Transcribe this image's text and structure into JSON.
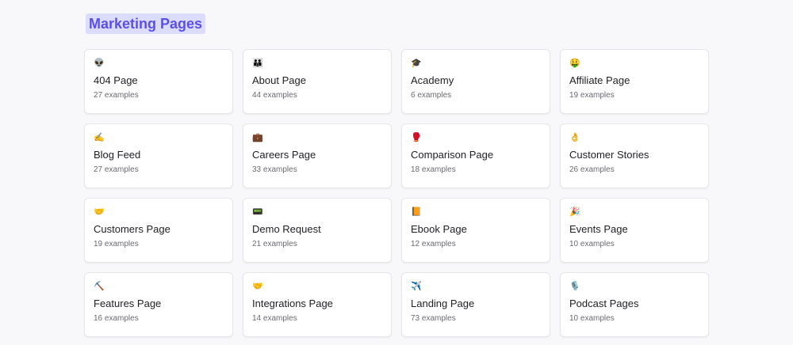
{
  "section": {
    "title": "Marketing Pages"
  },
  "cards": [
    {
      "emoji": "👽",
      "icon": "alien-icon",
      "name": "404 Page",
      "count": "27 examples"
    },
    {
      "emoji": "👪",
      "icon": "family-icon",
      "name": "About Page",
      "count": "44 examples"
    },
    {
      "emoji": "🎓",
      "icon": "graduation-cap-icon",
      "name": "Academy",
      "count": "6 examples"
    },
    {
      "emoji": "🤑",
      "icon": "money-face-icon",
      "name": "Affiliate Page",
      "count": "19 examples"
    },
    {
      "emoji": "✍️",
      "icon": "writing-hand-icon",
      "name": "Blog Feed",
      "count": "27 examples"
    },
    {
      "emoji": "💼",
      "icon": "briefcase-icon",
      "name": "Careers Page",
      "count": "33 examples"
    },
    {
      "emoji": "🥊",
      "icon": "boxing-glove-icon",
      "name": "Comparison Page",
      "count": "18 examples"
    },
    {
      "emoji": "👌",
      "icon": "ok-hand-icon",
      "name": "Customer Stories",
      "count": "26 examples"
    },
    {
      "emoji": "🤝",
      "icon": "handshake-icon",
      "name": "Customers Page",
      "count": "19 examples"
    },
    {
      "emoji": "📟",
      "icon": "device-icon",
      "name": "Demo Request",
      "count": "21 examples"
    },
    {
      "emoji": "📙",
      "icon": "book-icon",
      "name": "Ebook Page",
      "count": "12 examples"
    },
    {
      "emoji": "🎉",
      "icon": "party-popper-icon",
      "name": "Events Page",
      "count": "10 examples"
    },
    {
      "emoji": "⛏️",
      "icon": "pickaxe-icon",
      "name": "Features Page",
      "count": "16 examples"
    },
    {
      "emoji": "🤝",
      "icon": "handshake-icon",
      "name": "Integrations Page",
      "count": "14 examples"
    },
    {
      "emoji": "✈️",
      "icon": "airplane-icon",
      "name": "Landing Page",
      "count": "73 examples"
    },
    {
      "emoji": "🎙️",
      "icon": "microphone-icon",
      "name": "Podcast Pages",
      "count": "10 examples"
    }
  ]
}
